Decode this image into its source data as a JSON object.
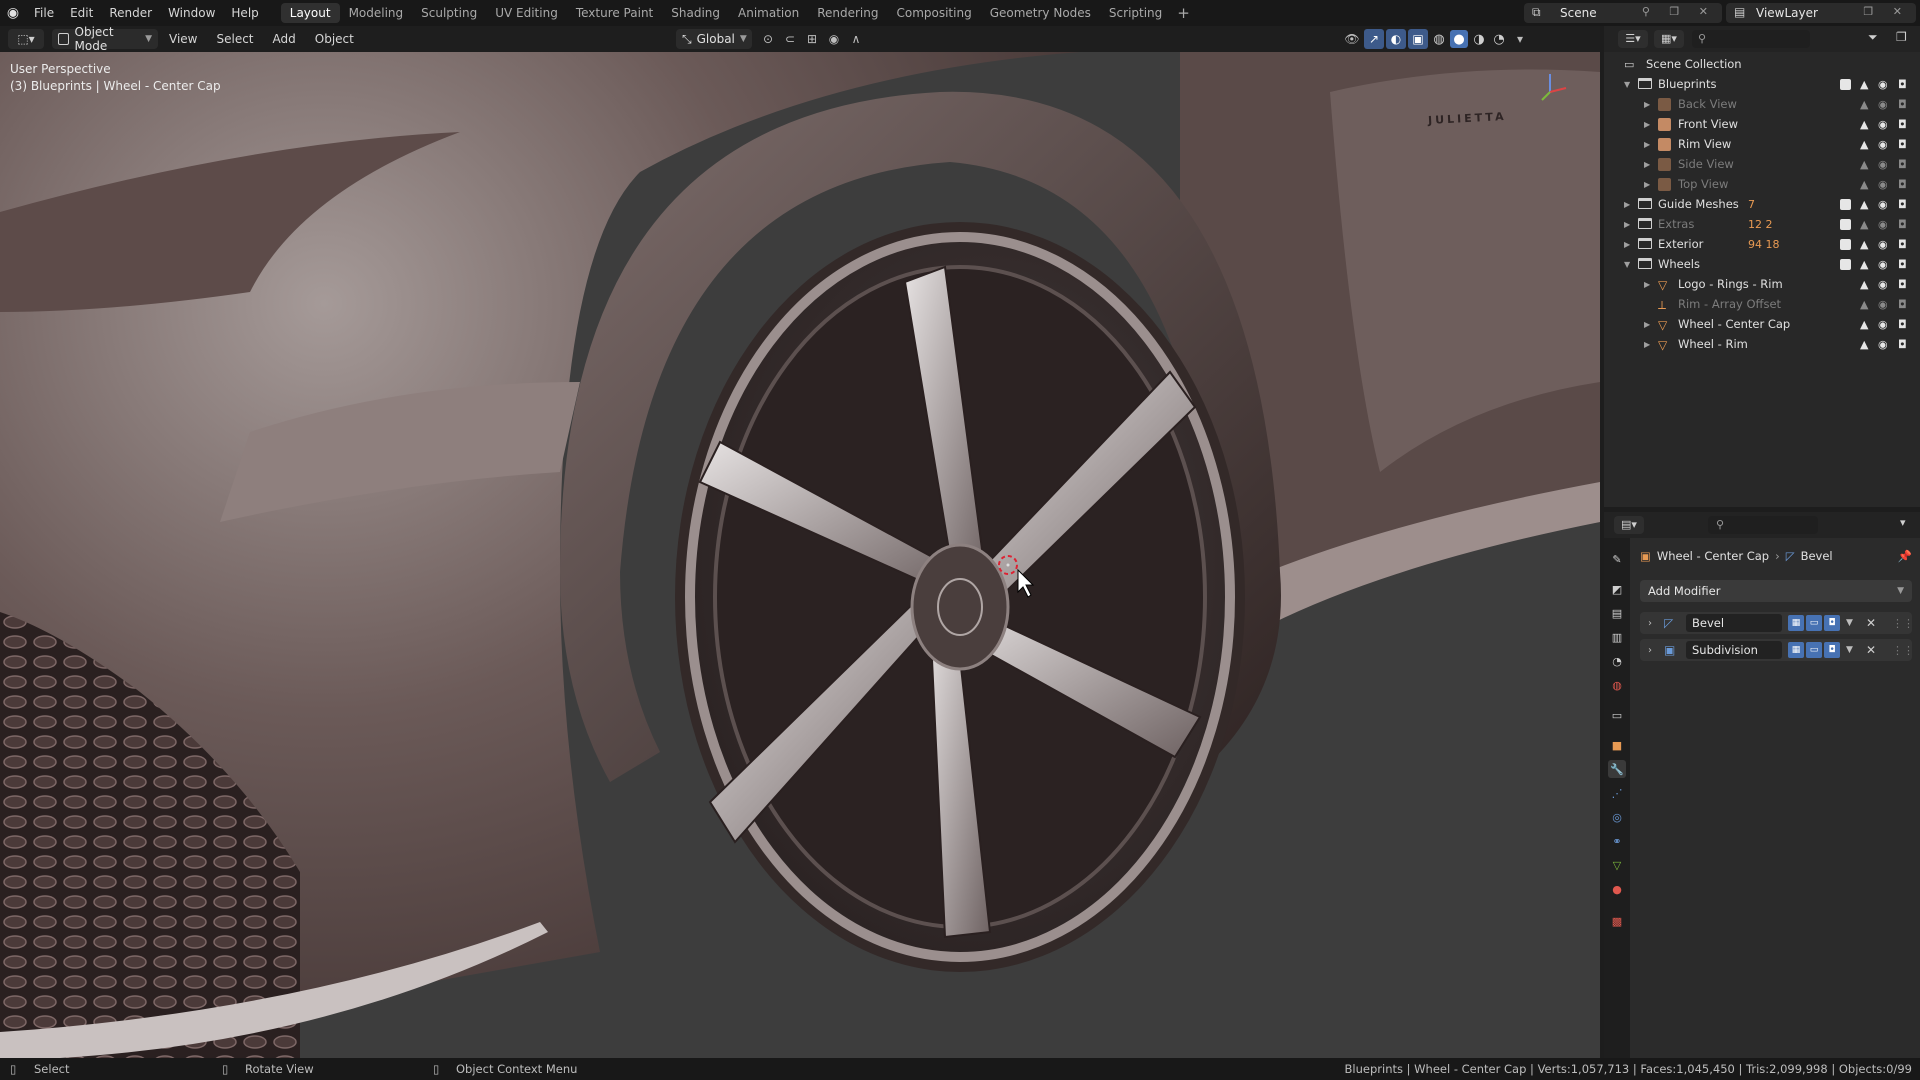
{
  "topbar": {
    "menus": [
      "File",
      "Edit",
      "Render",
      "Window",
      "Help"
    ],
    "workspaces": [
      "Layout",
      "Modeling",
      "Sculpting",
      "UV Editing",
      "Texture Paint",
      "Shading",
      "Animation",
      "Rendering",
      "Compositing",
      "Geometry Nodes",
      "Scripting"
    ],
    "active_workspace": "Layout",
    "add_tab": "+",
    "scene": "Scene",
    "view_layer": "ViewLayer"
  },
  "viewport_header": {
    "mode": "Object Mode",
    "menus": [
      "View",
      "Select",
      "Add",
      "Object"
    ],
    "transform_orientation": "Global"
  },
  "viewport": {
    "perspective": "User Perspective",
    "active_label": "(3) Blueprints | Wheel - Center Cap",
    "badge_text": "JULIETTA"
  },
  "outliner": {
    "root": "Scene Collection",
    "rows": [
      {
        "label": "Blueprints",
        "kind": "collection",
        "dim": false
      },
      {
        "label": "Back View",
        "kind": "image",
        "dim": true
      },
      {
        "label": "Front View",
        "kind": "image",
        "dim": false
      },
      {
        "label": "Rim View",
        "kind": "image",
        "dim": false
      },
      {
        "label": "Side View",
        "kind": "image",
        "dim": true
      },
      {
        "label": "Top View",
        "kind": "image",
        "dim": true
      },
      {
        "label": "Guide Meshes",
        "kind": "collection",
        "dim": false,
        "extra": "7"
      },
      {
        "label": "Extras",
        "kind": "collection",
        "dim": true,
        "extra": "12 2"
      },
      {
        "label": "Exterior",
        "kind": "collection",
        "dim": false,
        "extra": "94 18"
      },
      {
        "label": "Wheels",
        "kind": "collection",
        "dim": false
      },
      {
        "label": "Logo - Rings - Rim",
        "kind": "mesh",
        "dim": false
      },
      {
        "label": "Rim - Array Offset",
        "kind": "empty",
        "dim": true
      },
      {
        "label": "Wheel - Center Cap",
        "kind": "mesh",
        "dim": false
      },
      {
        "label": "Wheel - Rim",
        "kind": "mesh",
        "dim": false
      }
    ]
  },
  "properties": {
    "breadcrumb_object": "Wheel - Center Cap",
    "breadcrumb_modifier": "Bevel",
    "add_modifier": "Add Modifier",
    "modifiers": [
      {
        "name": "Bevel"
      },
      {
        "name": "Subdivision"
      }
    ]
  },
  "statusbar": {
    "select": "Select",
    "rotate": "Rotate View",
    "context_menu": "Object Context Menu",
    "stats": "Blueprints | Wheel - Center Cap | Verts:1,057,713 | Faces:1,045,450 | Tris:2,099,998 | Objects:0/99"
  }
}
